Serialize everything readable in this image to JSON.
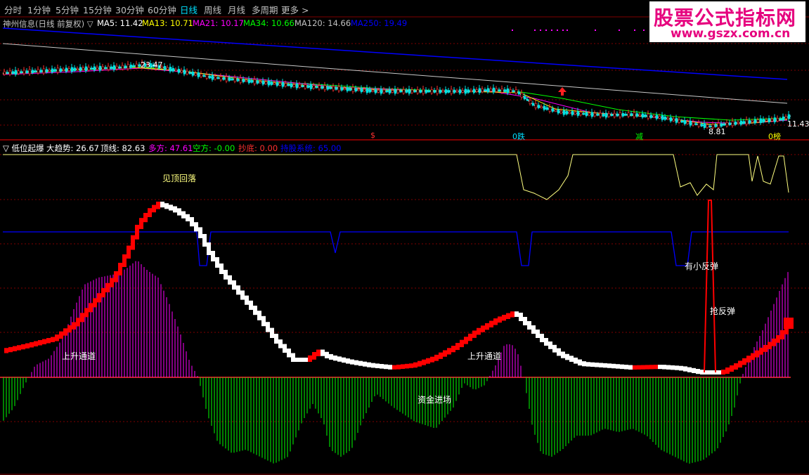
{
  "toolbar": {
    "tabs": [
      {
        "label": "分时"
      },
      {
        "label": "1分钟"
      },
      {
        "label": "5分钟"
      },
      {
        "label": "15分钟"
      },
      {
        "label": "30分钟"
      },
      {
        "label": "60分钟"
      },
      {
        "label": "日线",
        "active": true
      },
      {
        "label": "周线"
      },
      {
        "label": "月线"
      },
      {
        "label": "多周期"
      },
      {
        "label": "更多"
      }
    ],
    "more_arrow": ">"
  },
  "watermark": {
    "line1": "股票公式指标网",
    "line2": "www.gszx.com.cn"
  },
  "price_panel": {
    "title": "神州信息(日线 前复权)",
    "toggle": "▽",
    "ma": [
      {
        "label": "MA5: 11.42",
        "color": "#ffffff"
      },
      {
        "label": "MA13: 10.71",
        "color": "#ffff00"
      },
      {
        "label": "MA21: 10.17",
        "color": "#ff00ff"
      },
      {
        "label": "MA34: 10.66",
        "color": "#00ff00"
      },
      {
        "label": "MA120: 14.66",
        "color": "#c0c0c0"
      },
      {
        "label": "MA250: 19.49",
        "color": "#0000ff"
      }
    ],
    "high_label": "23.47",
    "low_label": "8.81",
    "last_label": "11.43",
    "signals": [
      {
        "text": "$",
        "color": "#ff3030"
      },
      {
        "text": "0跌",
        "color": "#00e0ff"
      },
      {
        "text": "减",
        "color": "#00ff00"
      },
      {
        "text": "0榜",
        "color": "#ffff00"
      }
    ]
  },
  "indicator_panel": {
    "toggle": "▽",
    "name": "低位起爆",
    "values": [
      {
        "label": "大趋势: 26.67",
        "color": "#ffffff"
      },
      {
        "label": "顶线: 82.63",
        "color": "#ffffff"
      },
      {
        "label": "多方: 47.61",
        "color": "#ff00ff"
      },
      {
        "label": "空方: -0.00",
        "color": "#00ff00"
      },
      {
        "label": "抄底: 0.00",
        "color": "#ff3030"
      },
      {
        "label": "持股系统: 65.00",
        "color": "#0000ff"
      }
    ],
    "annotations": {
      "top_falling": "见顶回落",
      "up_channel_1": "上升通道",
      "up_channel_2": "上升通道",
      "capital_in": "资金进场",
      "small_rebound": "有小反弹",
      "grab_rebound": "抢反弹"
    }
  },
  "colors": {
    "grid": "#800000",
    "rise": "#ff0000",
    "fall": "#ffffff",
    "bull": "#ff00ff",
    "bear": "#00ff00",
    "trend": "#0000ff",
    "top_line": "#ffff80"
  }
}
